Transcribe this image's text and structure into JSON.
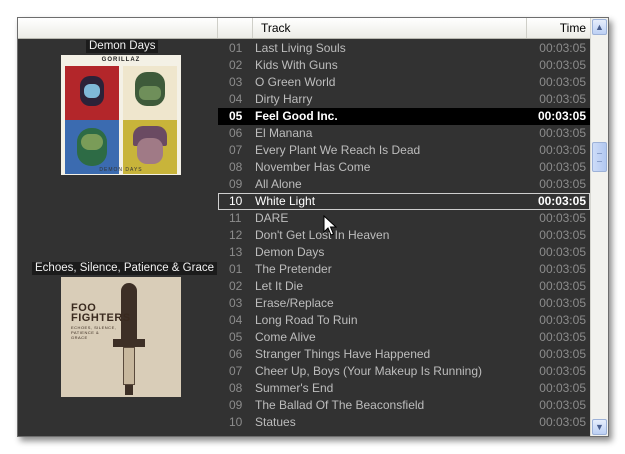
{
  "header": {
    "track_label": "Track",
    "time_label": "Time"
  },
  "scrollbar": {
    "up_glyph": "▲",
    "down_glyph": "▼",
    "position": 0.3
  },
  "albums": [
    {
      "title": "Demon Days",
      "cover_text": "GORILLAZ",
      "cover_footer": "DEMON DAYS"
    },
    {
      "title": "Echoes, Silence, Patience & Grace",
      "cover_text": "FOO FIGHTERS",
      "cover_footer": "ECHOES, SILENCE, PATIENCE & GRACE"
    }
  ],
  "tracks": [
    {
      "num": "01",
      "name": "Last Living Souls",
      "time": "00:03:05"
    },
    {
      "num": "02",
      "name": "Kids With Guns",
      "time": "00:03:05"
    },
    {
      "num": "03",
      "name": "O Green World",
      "time": "00:03:05"
    },
    {
      "num": "04",
      "name": "Dirty Harry",
      "time": "00:03:05"
    },
    {
      "num": "05",
      "name": "Feel Good Inc.",
      "time": "00:03:05",
      "state": "playing"
    },
    {
      "num": "06",
      "name": "El Manana",
      "time": "00:03:05"
    },
    {
      "num": "07",
      "name": "Every Plant We Reach Is Dead",
      "time": "00:03:05"
    },
    {
      "num": "08",
      "name": "November Has Come",
      "time": "00:03:05"
    },
    {
      "num": "09",
      "name": "All Alone",
      "time": "00:03:05"
    },
    {
      "num": "10",
      "name": "White Light",
      "time": "00:03:05",
      "state": "focused"
    },
    {
      "num": "11",
      "name": "DARE",
      "time": "00:03:05"
    },
    {
      "num": "12",
      "name": "Don't Get Lost In Heaven",
      "time": "00:03:05"
    },
    {
      "num": "13",
      "name": "Demon Days",
      "time": "00:03:05"
    },
    {
      "num": "01",
      "name": "The Pretender",
      "time": "00:03:05"
    },
    {
      "num": "02",
      "name": "Let It Die",
      "time": "00:03:05"
    },
    {
      "num": "03",
      "name": "Erase/Replace",
      "time": "00:03:05"
    },
    {
      "num": "04",
      "name": "Long Road To Ruin",
      "time": "00:03:05"
    },
    {
      "num": "05",
      "name": "Come Alive",
      "time": "00:03:05"
    },
    {
      "num": "06",
      "name": "Stranger Things Have Happened",
      "time": "00:03:05"
    },
    {
      "num": "07",
      "name": "Cheer Up, Boys (Your Makeup Is Running)",
      "time": "00:03:05"
    },
    {
      "num": "08",
      "name": "Summer's End",
      "time": "00:03:05"
    },
    {
      "num": "09",
      "name": "The Ballad Of The Beaconsfield",
      "time": "00:03:05"
    },
    {
      "num": "10",
      "name": "Statues",
      "time": "00:03:05"
    }
  ],
  "colors": {
    "background": "#323232",
    "playing_row": "#000000",
    "text": "#bdbdbd"
  }
}
